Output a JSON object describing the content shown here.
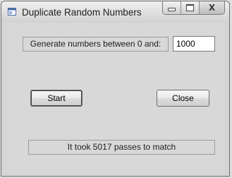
{
  "window": {
    "title": "Duplicate Random Numbers",
    "icon": "app-window-icon",
    "caption_buttons": [
      "minimize-icon",
      "maximize-icon",
      "close-icon"
    ],
    "close_glyph": "X"
  },
  "form": {
    "prompt_label": "Generate numbers between 0 and:",
    "max_value": "1000",
    "start_label": "Start",
    "close_label": "Close",
    "status": "It took 5017 passes to match"
  }
}
